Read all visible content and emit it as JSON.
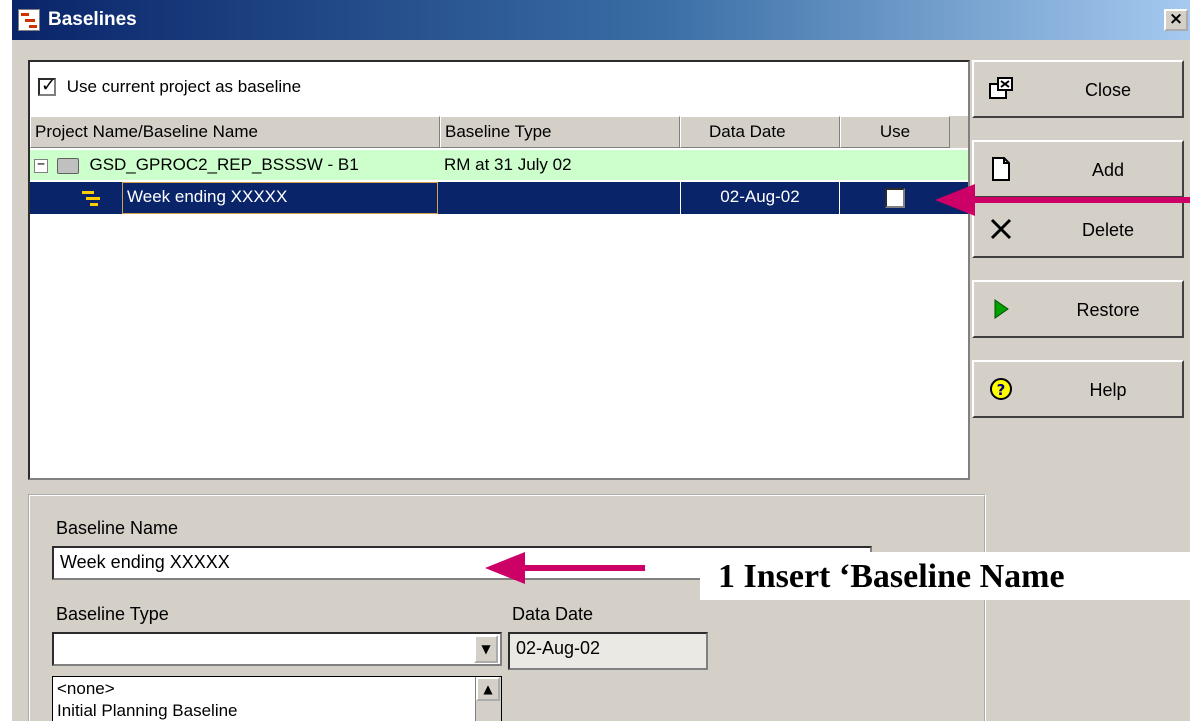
{
  "window": {
    "title": "Baselines",
    "close_glyph": "×"
  },
  "content": {
    "use_current_label": "Use current project as baseline",
    "use_current_checked": true,
    "columns": [
      "Project Name/Baseline Name",
      "Baseline Type",
      "Data Date",
      "Use"
    ],
    "group_row": {
      "expand_glyph": "−",
      "name": "GSD_GPROC2_REP_BSSSW - B1",
      "baseline_type": "RM at 31 July 02"
    },
    "selected_row": {
      "name": "Week ending XXXXX",
      "baseline_type": "",
      "data_date": "02-Aug-02",
      "use_checked": false
    }
  },
  "buttons": [
    {
      "label": "Close",
      "icon": "close-window-icon"
    },
    {
      "label": "Add",
      "icon": "new-document-icon"
    },
    {
      "label": "Delete",
      "icon": "delete-x-icon"
    },
    {
      "label": "Restore",
      "icon": "play-arrow-icon"
    },
    {
      "label": "Help",
      "icon": "help-icon"
    }
  ],
  "details": {
    "baseline_name_label": "Baseline Name",
    "baseline_name_value": "Week ending XXXXX",
    "baseline_type_label": "Baseline Type",
    "baseline_type_value": "",
    "data_date_label": "Data Date",
    "data_date_value": "02-Aug-02",
    "dropdown_options": [
      "<none>",
      "Initial Planning Baseline"
    ]
  },
  "annotation": {
    "text": "1 Insert ‘Baseline Name"
  },
  "colors": {
    "title_gradient_start": "#0a246a",
    "group_row_bg": "#ccffcc",
    "selected_row_bg": "#0a246a",
    "arrow": "#cc0066"
  }
}
